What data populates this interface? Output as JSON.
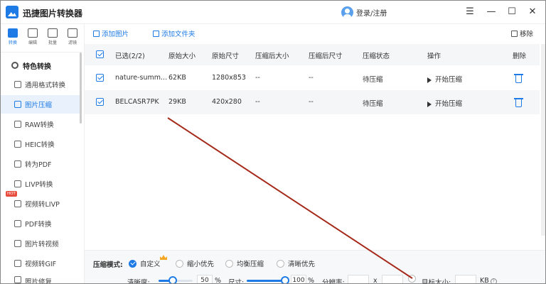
{
  "app": {
    "title": "迅捷图片转换器",
    "login": "登录/注册"
  },
  "window": {
    "menu": "☰",
    "minimize": "—",
    "maximize": "☐",
    "close": "✕"
  },
  "rail_tabs": [
    {
      "label": "转换",
      "active": true
    },
    {
      "label": "编辑"
    },
    {
      "label": "批量"
    },
    {
      "label": "滤镜"
    }
  ],
  "sidebar": {
    "header": "特色转换",
    "items": [
      {
        "label": "通用格式转换"
      },
      {
        "label": "图片压缩",
        "active": true
      },
      {
        "label": "RAW转换"
      },
      {
        "label": "HEIC转换"
      },
      {
        "label": "转为PDF"
      },
      {
        "label": "LIVP转换"
      },
      {
        "label": "视频转LIVP",
        "badge": "HOT"
      },
      {
        "label": "PDF转换"
      },
      {
        "label": "图片转视频"
      },
      {
        "label": "视频转GIF"
      },
      {
        "label": "照片修复"
      }
    ]
  },
  "toolbar": {
    "add_image": "添加图片",
    "add_folder": "添加文件夹",
    "remove": "移除"
  },
  "table": {
    "headers": [
      "已选(2/2)",
      "原始大小",
      "原始尺寸",
      "压缩后大小",
      "压缩后尺寸",
      "压缩状态",
      "操作",
      "删除"
    ],
    "rows": [
      {
        "name": "nature-summ...",
        "size": "62KB",
        "dims": "1280x853",
        "new_size": "--",
        "new_dims": "--",
        "status": "待压缩",
        "action": "开始压缩"
      },
      {
        "name": "BELCASR7PK",
        "size": "29KB",
        "dims": "420x280",
        "new_size": "--",
        "new_dims": "--",
        "status": "待压缩",
        "action": "开始压缩"
      }
    ]
  },
  "compress": {
    "mode_label": "压缩模式:",
    "modes": [
      {
        "label": "自定义",
        "selected": true
      },
      {
        "label": "缩小优先"
      },
      {
        "label": "均衡压缩"
      },
      {
        "label": "清晰优先"
      }
    ],
    "clarity_label": "清晰度:",
    "clarity_value": "50",
    "clarity_unit": "%",
    "size_label": "尺寸:",
    "size_value": "100",
    "size_unit": "%",
    "resolution_label": "分辨率:",
    "resolution_sep": "x",
    "target_label": "目标大小:",
    "target_unit": "KB",
    "help": "?"
  },
  "colors": {
    "accent": "#1e7be6",
    "annotation": "#a52a1a",
    "hot": "#e74c3c"
  }
}
